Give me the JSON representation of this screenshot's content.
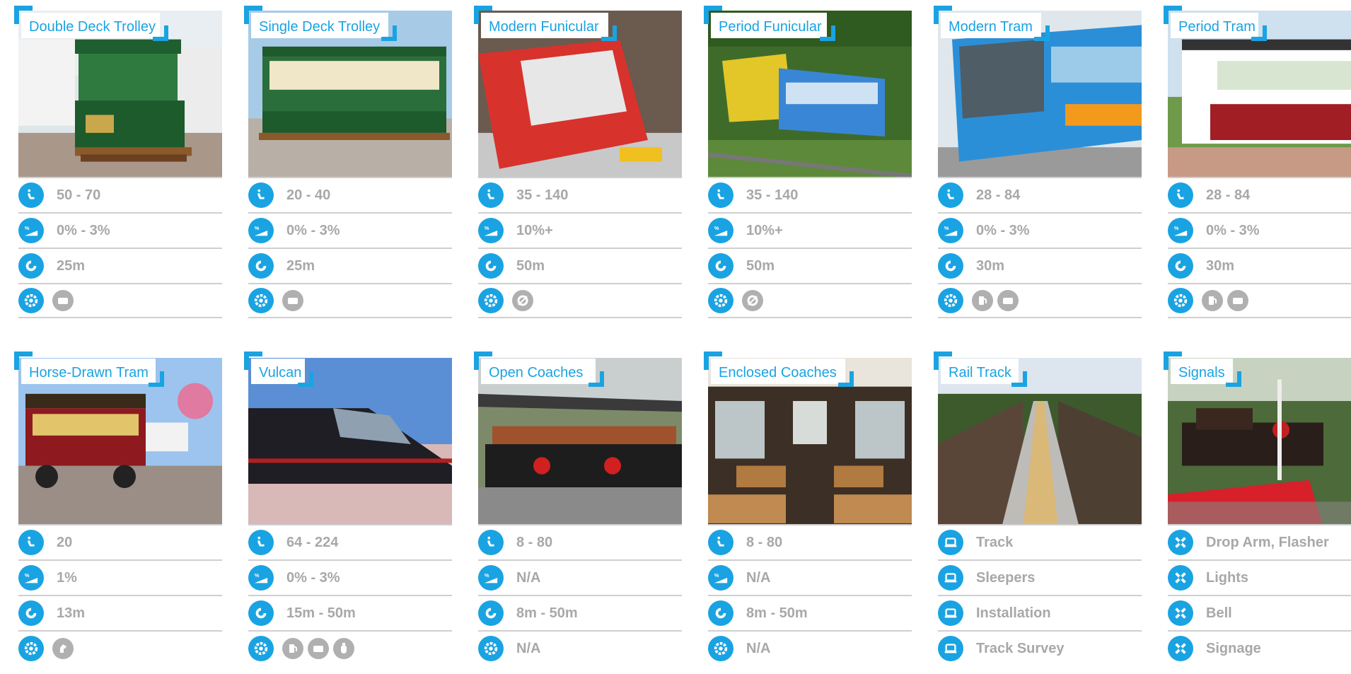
{
  "cards": [
    {
      "title": "Double Deck Trolley",
      "rows": [
        "50 - 70",
        "0% - 3%",
        "25m"
      ],
      "power": [
        "battery"
      ]
    },
    {
      "title": "Single Deck Trolley",
      "rows": [
        "20 - 40",
        "0% - 3%",
        "25m"
      ],
      "power": [
        "battery"
      ]
    },
    {
      "title": "Modern Funicular",
      "rows": [
        "35 - 140",
        "10%+",
        "50m"
      ],
      "power": [
        "cable"
      ]
    },
    {
      "title": "Period Funicular",
      "rows": [
        "35 - 140",
        "10%+",
        "50m"
      ],
      "power": [
        "cable"
      ]
    },
    {
      "title": "Modern Tram",
      "rows": [
        "28 - 84",
        "0% - 3%",
        "30m"
      ],
      "power": [
        "fuel",
        "battery"
      ]
    },
    {
      "title": "Period Tram",
      "rows": [
        "28 - 84",
        "0% - 3%",
        "30m"
      ],
      "power": [
        "fuel",
        "battery"
      ]
    },
    {
      "title": "Horse-Drawn Tram",
      "rows": [
        "20",
        "1%",
        "13m"
      ],
      "power": [
        "horse"
      ]
    },
    {
      "title": "Vulcan",
      "rows": [
        "64 - 224",
        "0% - 3%",
        "15m - 50m"
      ],
      "power": [
        "fuel",
        "battery",
        "gas"
      ]
    },
    {
      "title": "Open Coaches",
      "rows": [
        "8 - 80",
        "N/A",
        "8m - 50m",
        "N/A"
      ],
      "power": []
    },
    {
      "title": "Enclosed Coaches",
      "rows": [
        "8 - 80",
        "N/A",
        "8m - 50m",
        "N/A"
      ],
      "power": []
    },
    {
      "title": "Rail Track",
      "rows": [
        "Track",
        "Sleepers",
        "Installation",
        "Track Survey"
      ],
      "power": []
    },
    {
      "title": "Signals",
      "rows": [
        "Drop Arm, Flasher",
        "Lights",
        "Bell",
        "Signage"
      ],
      "power": []
    }
  ],
  "icons": {
    "capacity": "seat-passenger-icon",
    "gradient": "gradient-slope-icon",
    "radius": "turning-radius-icon",
    "power": "power-gear-icon",
    "track": "track-rail-icon",
    "signal": "signal-cross-icon"
  },
  "colors": {
    "accent": "#1aa3e2",
    "muted": "#a8a8a8",
    "divider": "#cfcfcf"
  }
}
